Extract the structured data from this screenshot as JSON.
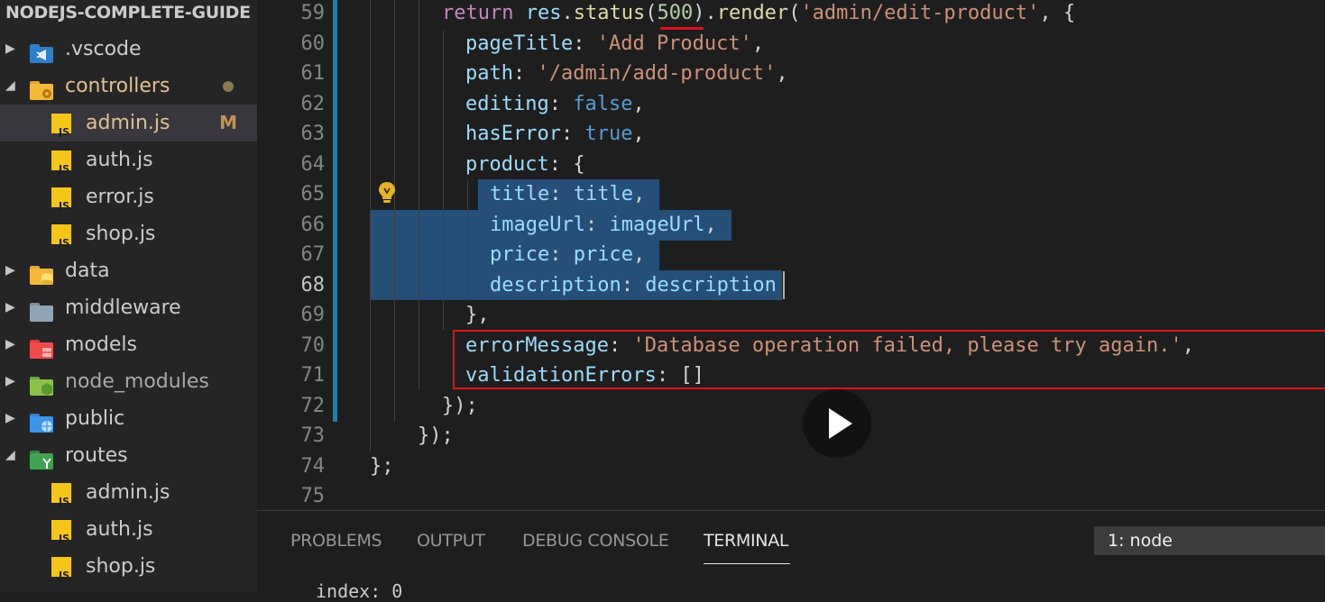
{
  "sidebar": {
    "title": "NODEJS-COMPLETE-GUIDE",
    "items": [
      {
        "label": ".vscode",
        "icon": "vscode-folder-icon",
        "type": "folder",
        "expanded": false
      },
      {
        "label": "controllers",
        "icon": "controllers-folder-icon",
        "type": "folder",
        "expanded": true,
        "modified_dot": true
      },
      {
        "label": "admin.js",
        "icon": "js-file-icon",
        "type": "file",
        "badge": "M",
        "selected": true
      },
      {
        "label": "auth.js",
        "icon": "js-file-icon",
        "type": "file"
      },
      {
        "label": "error.js",
        "icon": "js-file-icon",
        "type": "file"
      },
      {
        "label": "shop.js",
        "icon": "js-file-icon",
        "type": "file"
      },
      {
        "label": "data",
        "icon": "data-folder-icon",
        "type": "folder",
        "expanded": false
      },
      {
        "label": "middleware",
        "icon": "middleware-folder-icon",
        "type": "folder",
        "expanded": false
      },
      {
        "label": "models",
        "icon": "models-folder-icon",
        "type": "folder",
        "expanded": false
      },
      {
        "label": "node_modules",
        "icon": "node-modules-folder-icon",
        "type": "folder",
        "expanded": false
      },
      {
        "label": "public",
        "icon": "public-folder-icon",
        "type": "folder",
        "expanded": false
      },
      {
        "label": "routes",
        "icon": "routes-folder-icon",
        "type": "folder",
        "expanded": true
      },
      {
        "label": "admin.js",
        "icon": "js-file-icon",
        "type": "file"
      },
      {
        "label": "auth.js",
        "icon": "js-file-icon",
        "type": "file"
      },
      {
        "label": "shop.js",
        "icon": "js-file-icon",
        "type": "file"
      }
    ],
    "js_icon_text": "JS",
    "twisty_collapsed": "▶",
    "twisty_expanded": "◢"
  },
  "colors": {
    "selection": "#264f78",
    "error_box": "#d7151a",
    "modified_bar": "#1b81a8",
    "accent_js": "#f5c518"
  },
  "editor": {
    "line_numbers": [
      "59",
      "60",
      "61",
      "62",
      "63",
      "64",
      "65",
      "66",
      "67",
      "68",
      "69",
      "70",
      "71",
      "72",
      "73",
      "74",
      "75"
    ],
    "active_line": "68",
    "lines": [
      [
        [
          "kw",
          "return "
        ],
        [
          "var",
          "res"
        ],
        [
          "pun",
          "."
        ],
        [
          "fn",
          "status"
        ],
        [
          "pun",
          "("
        ],
        [
          "num",
          "500"
        ],
        [
          "pun",
          ")."
        ],
        [
          "fn",
          "render"
        ],
        [
          "pun",
          "("
        ],
        [
          "str",
          "'admin/edit-product'"
        ],
        [
          "pun",
          ", {"
        ]
      ],
      [
        [
          "var",
          "pageTitle"
        ],
        [
          "pun",
          ": "
        ],
        [
          "str",
          "'Add Product'"
        ],
        [
          "pun",
          ","
        ]
      ],
      [
        [
          "var",
          "path"
        ],
        [
          "pun",
          ": "
        ],
        [
          "str",
          "'/admin/add-product'"
        ],
        [
          "pun",
          ","
        ]
      ],
      [
        [
          "var",
          "editing"
        ],
        [
          "pun",
          ": "
        ],
        [
          "bool",
          "false"
        ],
        [
          "pun",
          ","
        ]
      ],
      [
        [
          "var",
          "hasError"
        ],
        [
          "pun",
          ": "
        ],
        [
          "bool",
          "true"
        ],
        [
          "pun",
          ","
        ]
      ],
      [
        [
          "var",
          "product"
        ],
        [
          "pun",
          ": {"
        ]
      ],
      [
        [
          "var",
          "title"
        ],
        [
          "pun",
          ": "
        ],
        [
          "var",
          "title"
        ],
        [
          "pun",
          ","
        ]
      ],
      [
        [
          "var",
          "imageUrl"
        ],
        [
          "pun",
          ": "
        ],
        [
          "var",
          "imageUrl"
        ],
        [
          "pun",
          ","
        ]
      ],
      [
        [
          "var",
          "price"
        ],
        [
          "pun",
          ": "
        ],
        [
          "var",
          "price"
        ],
        [
          "pun",
          ","
        ]
      ],
      [
        [
          "var",
          "description"
        ],
        [
          "pun",
          ": "
        ],
        [
          "var",
          "description"
        ]
      ],
      [
        [
          "pun",
          "},"
        ]
      ],
      [
        [
          "var",
          "errorMessage"
        ],
        [
          "pun",
          ": "
        ],
        [
          "str",
          "'Database operation failed, please try again.'"
        ],
        [
          "pun",
          ","
        ]
      ],
      [
        [
          "var",
          "validationErrors"
        ],
        [
          "pun",
          ": []"
        ]
      ],
      [
        [
          "pun",
          "});"
        ]
      ],
      [
        [
          "pun",
          "});"
        ]
      ],
      [
        [
          "pun",
          "};"
        ]
      ],
      []
    ]
  },
  "panel": {
    "tabs": [
      {
        "label": "PROBLEMS",
        "active": false
      },
      {
        "label": "OUTPUT",
        "active": false
      },
      {
        "label": "DEBUG CONSOLE",
        "active": false
      },
      {
        "label": "TERMINAL",
        "active": true
      }
    ],
    "terminal_select": "1: node",
    "terminal_text": "index: 0"
  }
}
